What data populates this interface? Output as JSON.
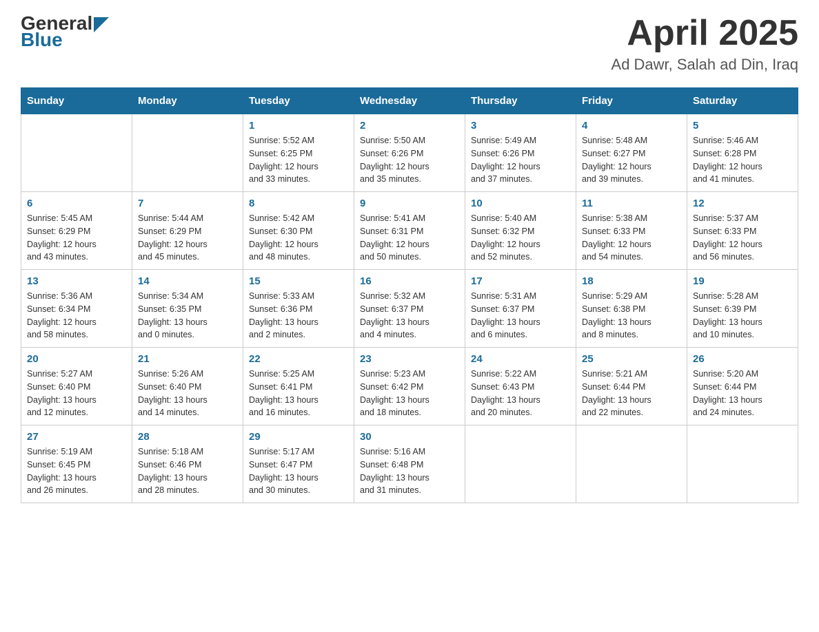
{
  "header": {
    "logo_general": "General",
    "logo_blue": "Blue",
    "title": "April 2025",
    "subtitle": "Ad Dawr, Salah ad Din, Iraq"
  },
  "days_of_week": [
    "Sunday",
    "Monday",
    "Tuesday",
    "Wednesday",
    "Thursday",
    "Friday",
    "Saturday"
  ],
  "weeks": [
    [
      {
        "day": "",
        "info": ""
      },
      {
        "day": "",
        "info": ""
      },
      {
        "day": "1",
        "info": "Sunrise: 5:52 AM\nSunset: 6:25 PM\nDaylight: 12 hours\nand 33 minutes."
      },
      {
        "day": "2",
        "info": "Sunrise: 5:50 AM\nSunset: 6:26 PM\nDaylight: 12 hours\nand 35 minutes."
      },
      {
        "day": "3",
        "info": "Sunrise: 5:49 AM\nSunset: 6:26 PM\nDaylight: 12 hours\nand 37 minutes."
      },
      {
        "day": "4",
        "info": "Sunrise: 5:48 AM\nSunset: 6:27 PM\nDaylight: 12 hours\nand 39 minutes."
      },
      {
        "day": "5",
        "info": "Sunrise: 5:46 AM\nSunset: 6:28 PM\nDaylight: 12 hours\nand 41 minutes."
      }
    ],
    [
      {
        "day": "6",
        "info": "Sunrise: 5:45 AM\nSunset: 6:29 PM\nDaylight: 12 hours\nand 43 minutes."
      },
      {
        "day": "7",
        "info": "Sunrise: 5:44 AM\nSunset: 6:29 PM\nDaylight: 12 hours\nand 45 minutes."
      },
      {
        "day": "8",
        "info": "Sunrise: 5:42 AM\nSunset: 6:30 PM\nDaylight: 12 hours\nand 48 minutes."
      },
      {
        "day": "9",
        "info": "Sunrise: 5:41 AM\nSunset: 6:31 PM\nDaylight: 12 hours\nand 50 minutes."
      },
      {
        "day": "10",
        "info": "Sunrise: 5:40 AM\nSunset: 6:32 PM\nDaylight: 12 hours\nand 52 minutes."
      },
      {
        "day": "11",
        "info": "Sunrise: 5:38 AM\nSunset: 6:33 PM\nDaylight: 12 hours\nand 54 minutes."
      },
      {
        "day": "12",
        "info": "Sunrise: 5:37 AM\nSunset: 6:33 PM\nDaylight: 12 hours\nand 56 minutes."
      }
    ],
    [
      {
        "day": "13",
        "info": "Sunrise: 5:36 AM\nSunset: 6:34 PM\nDaylight: 12 hours\nand 58 minutes."
      },
      {
        "day": "14",
        "info": "Sunrise: 5:34 AM\nSunset: 6:35 PM\nDaylight: 13 hours\nand 0 minutes."
      },
      {
        "day": "15",
        "info": "Sunrise: 5:33 AM\nSunset: 6:36 PM\nDaylight: 13 hours\nand 2 minutes."
      },
      {
        "day": "16",
        "info": "Sunrise: 5:32 AM\nSunset: 6:37 PM\nDaylight: 13 hours\nand 4 minutes."
      },
      {
        "day": "17",
        "info": "Sunrise: 5:31 AM\nSunset: 6:37 PM\nDaylight: 13 hours\nand 6 minutes."
      },
      {
        "day": "18",
        "info": "Sunrise: 5:29 AM\nSunset: 6:38 PM\nDaylight: 13 hours\nand 8 minutes."
      },
      {
        "day": "19",
        "info": "Sunrise: 5:28 AM\nSunset: 6:39 PM\nDaylight: 13 hours\nand 10 minutes."
      }
    ],
    [
      {
        "day": "20",
        "info": "Sunrise: 5:27 AM\nSunset: 6:40 PM\nDaylight: 13 hours\nand 12 minutes."
      },
      {
        "day": "21",
        "info": "Sunrise: 5:26 AM\nSunset: 6:40 PM\nDaylight: 13 hours\nand 14 minutes."
      },
      {
        "day": "22",
        "info": "Sunrise: 5:25 AM\nSunset: 6:41 PM\nDaylight: 13 hours\nand 16 minutes."
      },
      {
        "day": "23",
        "info": "Sunrise: 5:23 AM\nSunset: 6:42 PM\nDaylight: 13 hours\nand 18 minutes."
      },
      {
        "day": "24",
        "info": "Sunrise: 5:22 AM\nSunset: 6:43 PM\nDaylight: 13 hours\nand 20 minutes."
      },
      {
        "day": "25",
        "info": "Sunrise: 5:21 AM\nSunset: 6:44 PM\nDaylight: 13 hours\nand 22 minutes."
      },
      {
        "day": "26",
        "info": "Sunrise: 5:20 AM\nSunset: 6:44 PM\nDaylight: 13 hours\nand 24 minutes."
      }
    ],
    [
      {
        "day": "27",
        "info": "Sunrise: 5:19 AM\nSunset: 6:45 PM\nDaylight: 13 hours\nand 26 minutes."
      },
      {
        "day": "28",
        "info": "Sunrise: 5:18 AM\nSunset: 6:46 PM\nDaylight: 13 hours\nand 28 minutes."
      },
      {
        "day": "29",
        "info": "Sunrise: 5:17 AM\nSunset: 6:47 PM\nDaylight: 13 hours\nand 30 minutes."
      },
      {
        "day": "30",
        "info": "Sunrise: 5:16 AM\nSunset: 6:48 PM\nDaylight: 13 hours\nand 31 minutes."
      },
      {
        "day": "",
        "info": ""
      },
      {
        "day": "",
        "info": ""
      },
      {
        "day": "",
        "info": ""
      }
    ]
  ]
}
